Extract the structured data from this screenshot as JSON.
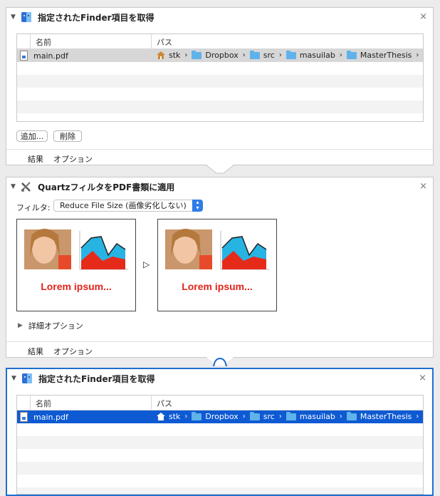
{
  "cards": [
    {
      "title": "指定されたFinder項目を取得",
      "table": {
        "col_name": "名前",
        "col_path": "パス",
        "row": {
          "name": "main.pdf",
          "path": [
            "stk",
            "Dropbox",
            "src",
            "masuilab",
            "MasterThesis"
          ]
        }
      },
      "add_label": "追加...",
      "delete_label": "削除",
      "tabs": [
        "結果",
        "オプション"
      ]
    },
    {
      "title": "QuartzフィルタをPDF書類に適用",
      "filter_label": "フィルタ:",
      "filter_value": "Reduce File Size (画像劣化しない)",
      "preview_text_before": "Lorem ipsum...",
      "preview_text_after": "Lorem ipsum...",
      "details": "詳細オプション",
      "tabs": [
        "結果",
        "オプション"
      ]
    },
    {
      "title": "指定されたFinder項目を取得",
      "table": {
        "col_name": "名前",
        "col_path": "パス",
        "row": {
          "name": "main.pdf",
          "path": [
            "stk",
            "Dropbox",
            "src",
            "masuilab",
            "MasterThesis"
          ]
        }
      }
    }
  ],
  "close_glyph": "×",
  "colors": {
    "selection": "#0e5ad3",
    "accent": "#2f7be8",
    "lorem": "#e1251b"
  }
}
